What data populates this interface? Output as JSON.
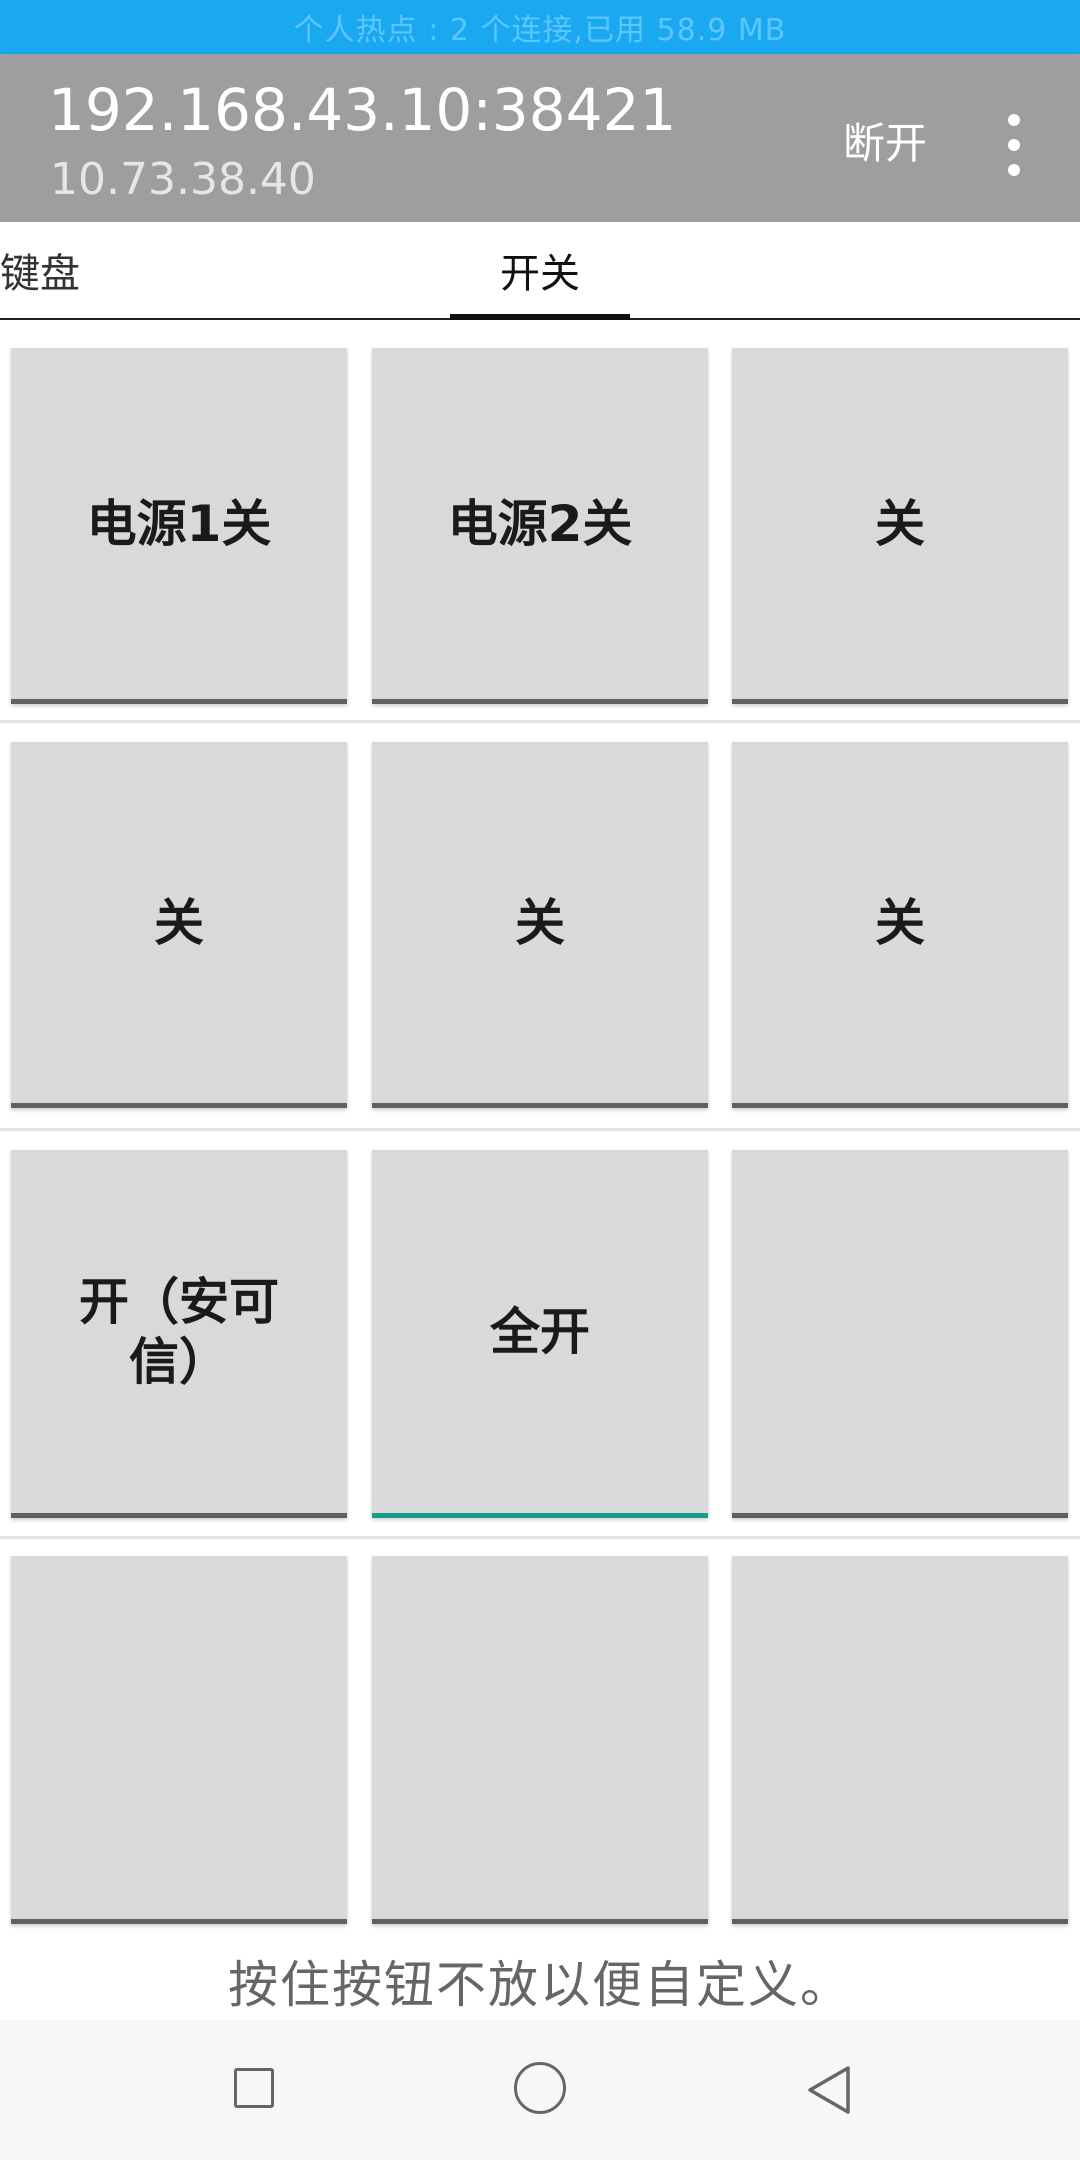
{
  "status_bar": {
    "text": "个人热点 : 2 个连接,已用 58.9 MB"
  },
  "app_bar": {
    "title": "192.168.43.10:38421",
    "subtitle": "10.73.38.40",
    "disconnect_label": "断开",
    "overflow_icon": "more-vert-icon"
  },
  "tabs": [
    {
      "label": "键盘",
      "selected": false
    },
    {
      "label": "开关",
      "selected": true
    }
  ],
  "buttons": [
    {
      "label": "电源1关",
      "active": false
    },
    {
      "label": "电源2关",
      "active": false
    },
    {
      "label": "关",
      "active": false
    },
    {
      "label": "关",
      "active": false
    },
    {
      "label": "关",
      "active": false
    },
    {
      "label": "关",
      "active": false
    },
    {
      "label": "开（安可信）",
      "active": false
    },
    {
      "label": "全开",
      "active": true
    },
    {
      "label": "",
      "active": false
    },
    {
      "label": "",
      "active": false
    },
    {
      "label": "",
      "active": false
    },
    {
      "label": "",
      "active": false
    }
  ],
  "hint": "按住按钮不放以便自定义。",
  "nav_bar": {
    "recents_icon": "square-icon",
    "home_icon": "circle-icon",
    "back_icon": "triangle-back-icon"
  },
  "colors": {
    "status_bar": "#1aa8f0",
    "app_bar": "#9e9e9e",
    "button_bg": "#d8d9d9",
    "button_underline": "#606060",
    "button_underline_active": "#159c8b"
  }
}
